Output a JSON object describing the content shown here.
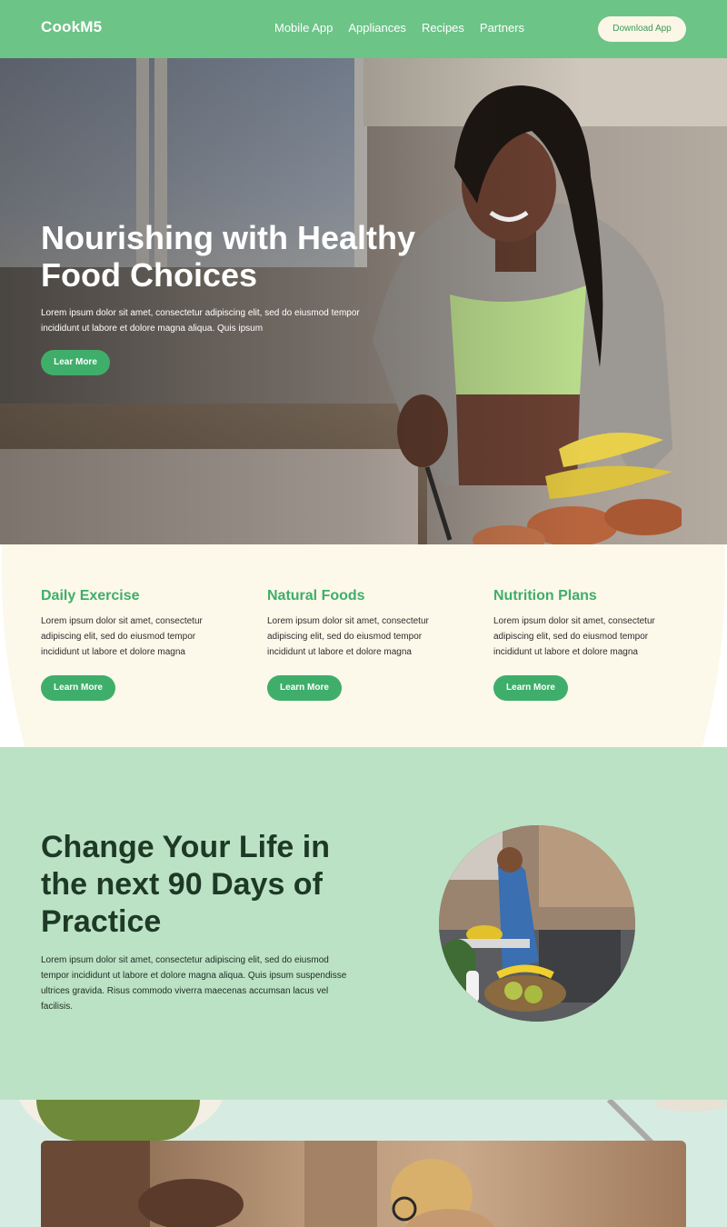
{
  "nav": {
    "logo": "CookM5",
    "links": [
      "Mobile App",
      "Appliances",
      "Recipes",
      "Partners"
    ],
    "download_label": "Download App"
  },
  "hero": {
    "title": "Nourishing with Healthy Food Choices",
    "body": "Lorem ipsum dolor sit amet, consectetur adipiscing elit, sed do eiusmod tempor incididunt ut labore et dolore magna aliqua. Quis ipsum",
    "cta_label": "Lear More"
  },
  "features": [
    {
      "title": "Daily Exercise",
      "body": "Lorem ipsum dolor sit amet, consectetur adipiscing elit, sed do eiusmod tempor incididunt ut labore et dolore magna",
      "cta_label": "Learn More"
    },
    {
      "title": "Natural Foods",
      "body": "Lorem ipsum dolor sit amet, consectetur adipiscing elit, sed do eiusmod tempor incididunt ut labore et dolore magna",
      "cta_label": "Learn More"
    },
    {
      "title": "Nutrition Plans",
      "body": "Lorem ipsum dolor sit amet, consectetur adipiscing elit, sed do eiusmod tempor incididunt ut labore et dolore magna",
      "cta_label": "Learn More"
    }
  ],
  "change": {
    "title": "Change Your Life in the next 90 Days of Practice",
    "body": "Lorem ipsum dolor sit amet, consectetur adipiscing elit, sed do eiusmod tempor incididunt ut labore et dolore magna aliqua. Quis ipsum suspendisse ultrices gravida. Risus commodo viverra maecenas accumsan lacus vel facilisis."
  },
  "colors": {
    "nav_bg": "#6cc487",
    "accent_green": "#3fae6a",
    "cream": "#fcf8ea",
    "mint": "#bbe2c4",
    "dark_heading": "#1e3a27"
  }
}
